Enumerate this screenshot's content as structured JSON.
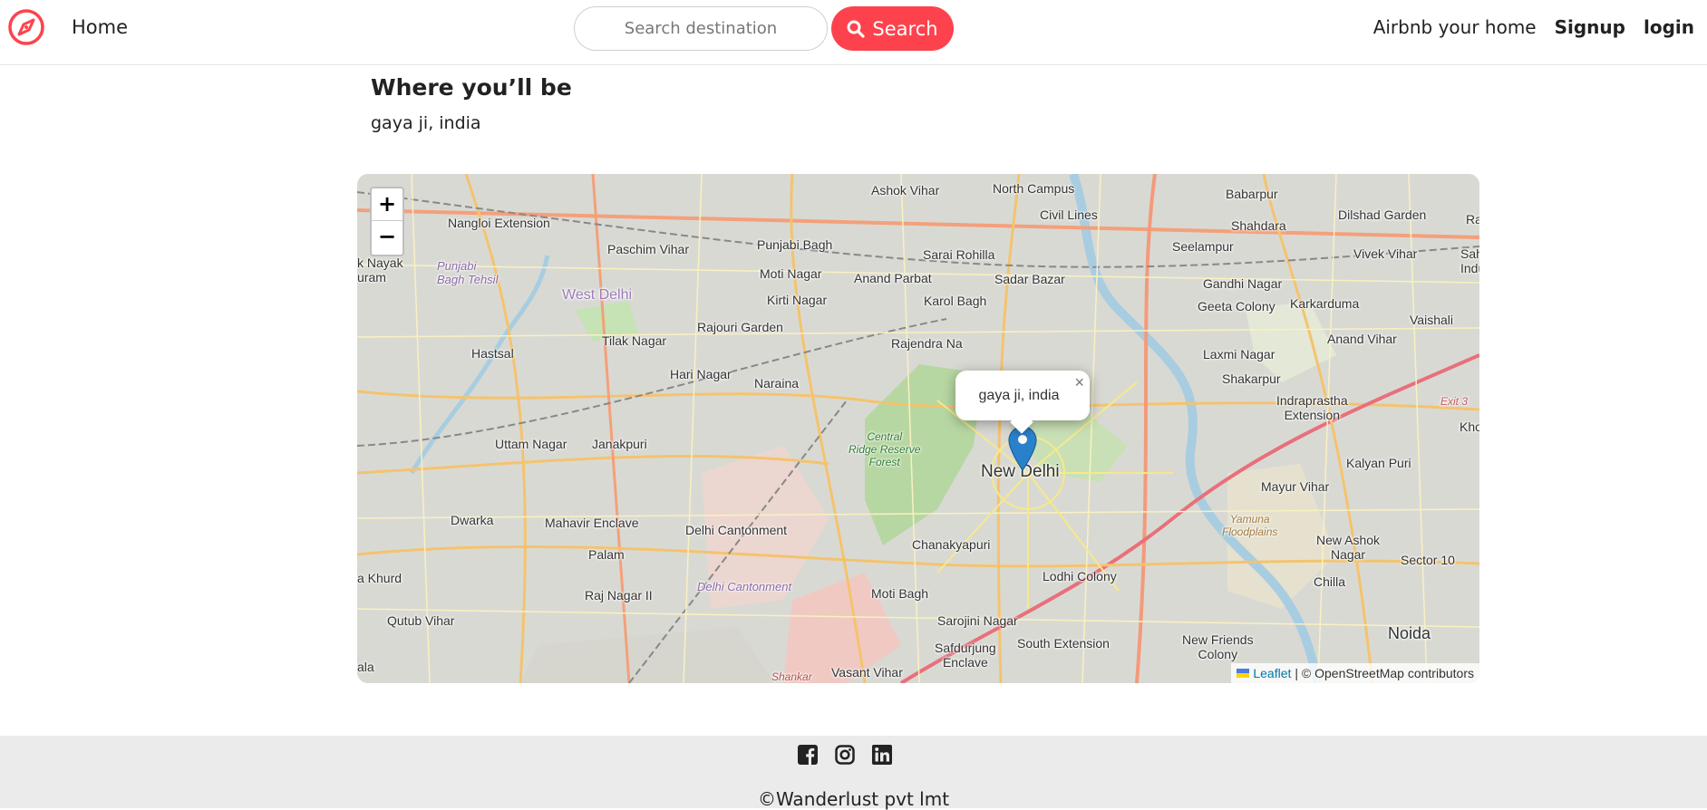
{
  "nav": {
    "brand_icon": "compass-icon",
    "home_label": "Home",
    "search_placeholder": "Search destination",
    "search_value": "",
    "search_button_label": "Search",
    "host_label": "Airbnb your home",
    "signup_label": "Signup",
    "login_label": "login",
    "accent_color": "#fe424d"
  },
  "listing": {
    "section_title": "Where you’ll be",
    "location": "gaya ji, india"
  },
  "map": {
    "zoom_in_label": "+",
    "zoom_out_label": "−",
    "popup_text": "gaya ji, india",
    "popup_close": "×",
    "attribution_link": "Leaflet",
    "attribution_text": "| © OpenStreetMap contributors",
    "labels": {
      "ashok_vihar": "Ashok Vihar",
      "north_campus": "North Campus",
      "babarpur": "Babarpur",
      "nangloi_extension": "Nangloi Extension",
      "civil_lines": "Civil Lines",
      "shahdara": "Shahdara",
      "dilshad_garden": "Dilshad Garden",
      "paschim_vihar": "Paschim Vihar",
      "punjabi_bagh": "Punjabi Bagh",
      "sarai_rohilla": "Sarai Rohilla",
      "seelampur": "Seelampur",
      "vivek_vihar": "Vivek Vihar",
      "nayak_puram": "k Nayak\nuram",
      "punjabi_bagh_tehsil": "Punjabi\nBagh Tehsil",
      "moti_nagar": "Moti Nagar",
      "anand_parbat": "Anand Parbat",
      "sadar_bazar": "Sadar Bazar",
      "gandhi_nagar": "Gandhi Nagar",
      "west_delhi": "West Delhi",
      "kirti_nagar": "Kirti Nagar",
      "karol_bagh": "Karol Bagh",
      "geeta_colony": "Geeta Colony",
      "karkarduma": "Karkarduma",
      "vaishali": "Vaishali",
      "rajouri_garden": "Rajouri Garden",
      "tilak_nagar": "Tilak Nagar",
      "rajendra_nagar": "Rajendra Na",
      "laxmi_nagar": "Laxmi Nagar",
      "anand_vihar": "Anand Vihar",
      "hastsal": "Hastsal",
      "hari_nagar": "Hari Nagar",
      "naraina": "Naraina",
      "shakarpur": "Shakarpur",
      "indraprastha_extension": "Indraprastha\nExtension",
      "uttam_nagar": "Uttam Nagar",
      "janakpuri": "Janakpuri",
      "central_ridge": "Central\nRidge Reserve\nForest",
      "new_delhi": "New Delhi",
      "kalyan_puri": "Kalyan Puri",
      "mayur_vihar": "Mayur Vihar",
      "dwarka": "Dwarka",
      "mahavir_enclave": "Mahavir Enclave",
      "delhi_cantonment": "Delhi Cantonment",
      "yamuna_floodplains": "Yamuna\nFloodplains",
      "new_ashok_nagar": "New Ashok\nNagar",
      "palam": "Palam",
      "chanakyapuri": "Chanakyapuri",
      "lodhi_colony": "Lodhi Colony",
      "sector_10": "Sector 10",
      "a_khurd": "a Khurd",
      "delhi_cantonment_area": "Delhi Cantonment",
      "chilla": "Chilla",
      "raj_nagar_ii": "Raj Nagar II",
      "moti_bagh": "Moti Bagh",
      "qutub_vihar": "Qutub Vihar",
      "sarojini_nagar": "Sarojini Nagar",
      "new_friends_colony": "New Friends\nColony",
      "noida": "Noida",
      "safdurjung": "Safdurjung\nEnclave",
      "south_extension": "South Extension",
      "vasant_vihar": "Vasant Vihar",
      "shankar": "Shankar",
      "ala": "ala",
      "exit3": "Exit 3",
      "ra": "Ra",
      "sah_indus": "Sah\nIndus",
      "kho": "Kho"
    }
  },
  "footer": {
    "social": [
      "facebook-icon",
      "instagram-icon",
      "linkedin-icon"
    ],
    "copyright": "©Wanderlust pvt lmt"
  }
}
